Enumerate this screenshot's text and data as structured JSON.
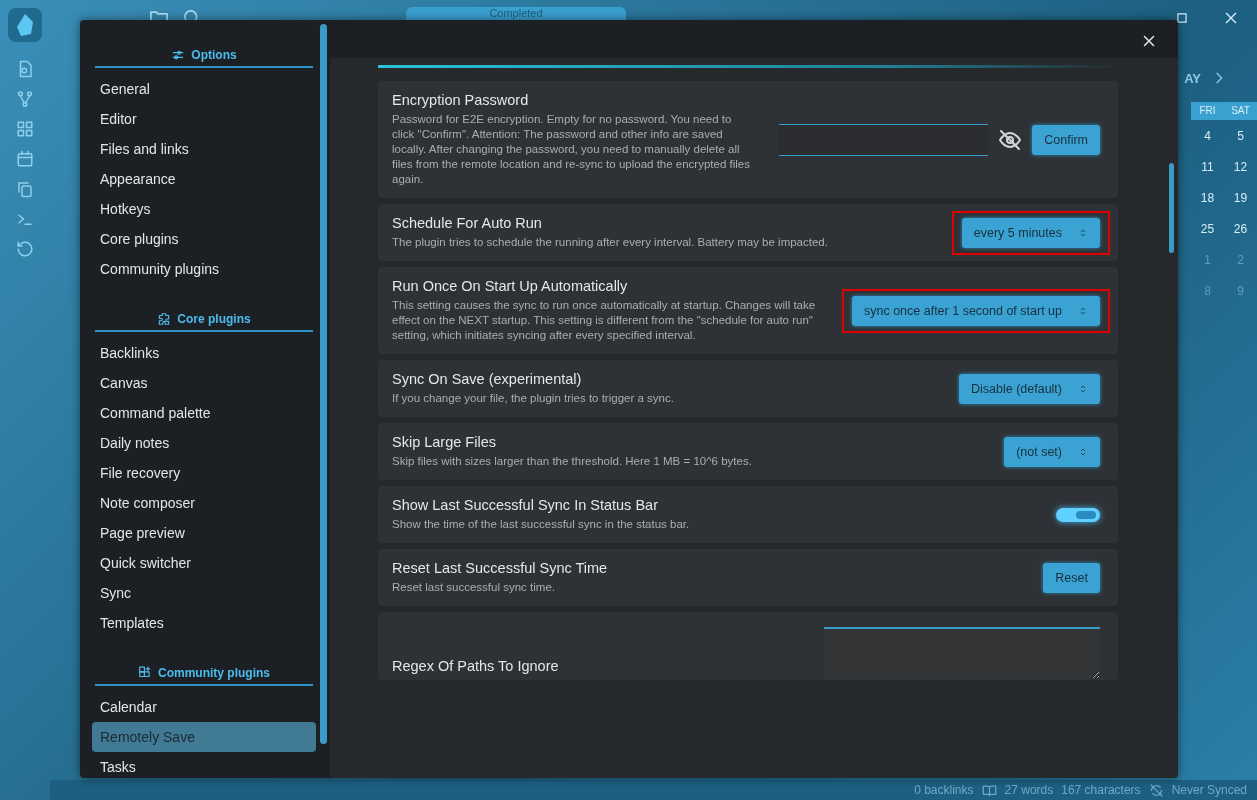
{
  "tab": {
    "title": "Completed"
  },
  "modal": {
    "sidebar": {
      "sections": [
        {
          "heading": "Options",
          "items": [
            {
              "label": "General",
              "selected": false
            },
            {
              "label": "Editor",
              "selected": false
            },
            {
              "label": "Files and links",
              "selected": false
            },
            {
              "label": "Appearance",
              "selected": false
            },
            {
              "label": "Hotkeys",
              "selected": false
            },
            {
              "label": "Core plugins",
              "selected": false
            },
            {
              "label": "Community plugins",
              "selected": false
            }
          ]
        },
        {
          "heading": "Core plugins",
          "items": [
            {
              "label": "Backlinks",
              "selected": false
            },
            {
              "label": "Canvas",
              "selected": false
            },
            {
              "label": "Command palette",
              "selected": false
            },
            {
              "label": "Daily notes",
              "selected": false
            },
            {
              "label": "File recovery",
              "selected": false
            },
            {
              "label": "Note composer",
              "selected": false
            },
            {
              "label": "Page preview",
              "selected": false
            },
            {
              "label": "Quick switcher",
              "selected": false
            },
            {
              "label": "Sync",
              "selected": false
            },
            {
              "label": "Templates",
              "selected": false
            }
          ]
        },
        {
          "heading": "Community plugins",
          "items": [
            {
              "label": "Calendar",
              "selected": false
            },
            {
              "label": "Remotely Save",
              "selected": true
            },
            {
              "label": "Tasks",
              "selected": false
            }
          ]
        }
      ]
    },
    "settings": [
      {
        "kind": "password",
        "title": "Encryption Password",
        "description": "Password for E2E encryption. Empty for no password. You need to click \"Confirm\". Attention: The password and other info are saved locally. After changing the password, you need to manually delete all files from the remote location and re-sync to upload the encrypted files again.",
        "button": "Confirm",
        "highlighted": false
      },
      {
        "kind": "dropdown",
        "title": "Schedule For Auto Run",
        "description": "The plugin tries to schedule the running after every interval. Battery may be impacted.",
        "value": "every 5 minutes",
        "highlighted": true
      },
      {
        "kind": "dropdown",
        "title": "Run Once On Start Up Automatically",
        "description": "This setting causes the sync to run once automatically at startup. Changes will take effect on the NEXT startup. This setting is different from the \"schedule for auto run\" setting, which initiates syncing after every specified interval.",
        "value": "sync once after 1 second of start up",
        "highlighted": true
      },
      {
        "kind": "dropdown",
        "title": "Sync On Save (experimental)",
        "description": "If you change your file, the plugin tries to trigger a sync.",
        "value": "Disable (default)",
        "highlighted": false
      },
      {
        "kind": "dropdown",
        "title": "Skip Large Files",
        "description": "Skip files with sizes larger than the threshold. Here 1 MB = 10^6 bytes.",
        "value": "(not set)",
        "highlighted": false
      },
      {
        "kind": "toggle",
        "title": "Show Last Successful Sync In Status Bar",
        "description": "Show the time of the last successful sync in the status bar.",
        "on": true,
        "highlighted": false
      },
      {
        "kind": "button",
        "title": "Reset Last Successful Sync Time",
        "description": "Reset last successful sync time.",
        "button": "Reset",
        "highlighted": false
      },
      {
        "kind": "textarea",
        "title": "Regex Of Paths To Ignore",
        "highlighted": false
      }
    ]
  },
  "calendar": {
    "heading": "AY",
    "weekdays": [
      "FRI",
      "SAT"
    ],
    "weeks": [
      [
        "4",
        "5"
      ],
      [
        "11",
        "12"
      ],
      [
        "18",
        "19"
      ],
      [
        "25",
        "26"
      ],
      [
        "1",
        "2"
      ],
      [
        "8",
        "9"
      ]
    ]
  },
  "status_bar": {
    "backlinks": "0 backlinks",
    "words": "27 words",
    "characters": "167 characters",
    "sync": "Never Synced"
  }
}
